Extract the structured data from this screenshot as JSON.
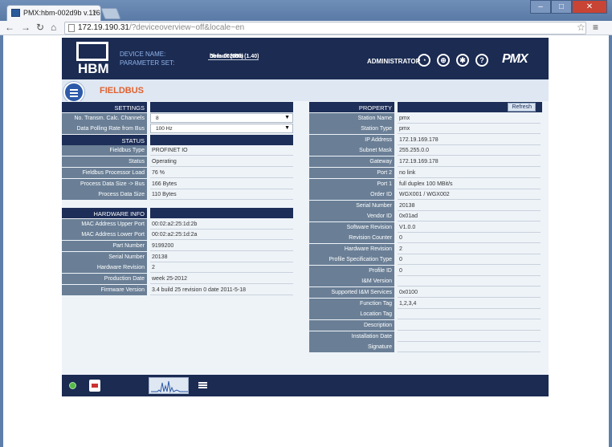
{
  "browser": {
    "tab_title": "PMX:hbm-002d9b v.116...",
    "url_host": "172.19.190.31",
    "url_rest": "/?deviceoverview~off&locale~en"
  },
  "header": {
    "logo_text": "HBM",
    "device_name_label": "DEVICE NAME:",
    "device_name": "hbm-002d9b (1.40)",
    "parameter_set_label": "PARAMETER SET:",
    "parameter_set": "Default (000)",
    "user": "ADMINISTRATOR",
    "brand": "PMX",
    "icons": [
      "gauge-icon",
      "globe-icon",
      "gear-icon",
      "help-icon"
    ]
  },
  "page": {
    "title": "FIELDBUS"
  },
  "settings": {
    "title": "SETTINGS",
    "rows": [
      {
        "label": "No. Transm. Calc. Channels",
        "value": "8"
      },
      {
        "label": "Data Polling Rate from Bus",
        "value": "100 Hz"
      }
    ]
  },
  "status": {
    "title": "STATUS",
    "rows": [
      {
        "label": "Fieldbus Type",
        "value": "PROFINET IO"
      },
      {
        "label": "Status",
        "value": "Operating"
      },
      {
        "label": "Fieldbus Processor Load",
        "value": "76 %"
      },
      {
        "label": "Process Data Size -> Bus",
        "value": "166 Bytes"
      },
      {
        "label": "Process Data Size",
        "value": "110 Bytes"
      }
    ]
  },
  "hardware": {
    "title": "HARDWARE INFO",
    "rows": [
      {
        "label": "MAC Address Upper Port",
        "value": "00:02:a2:25:1d:2b"
      },
      {
        "label": "MAC Address Lower Port",
        "value": "00:02:a2:25:1d:2a"
      },
      {
        "label": "Part Number",
        "value": "9199200"
      },
      {
        "label": "Serial Number",
        "value": "20138"
      },
      {
        "label": "Hardware Revision",
        "value": "2"
      },
      {
        "label": "Production Date",
        "value": "week 25-2012"
      },
      {
        "label": "Firmware Version",
        "value": "3.4 build 25 revision 0 date 2011-5-18"
      }
    ]
  },
  "property": {
    "title": "PROPERTY",
    "refresh_label": "Refresh",
    "rows": [
      {
        "label": "Station Name",
        "value": "pmx"
      },
      {
        "label": "Station Type",
        "value": "pmx"
      },
      {
        "label": "IP Address",
        "value": "172.19.169.178"
      },
      {
        "label": "Subnet Mask",
        "value": "255.255.0.0"
      },
      {
        "label": "Gateway",
        "value": "172.19.169.178"
      },
      {
        "label": "Port 2",
        "value": "no link"
      },
      {
        "label": "Port 1",
        "value": "full duplex 100 MBit/s"
      },
      {
        "label": "Order ID",
        "value": "WGX001 / WGX002"
      },
      {
        "label": "Serial Number",
        "value": "20138"
      },
      {
        "label": "Vendor ID",
        "value": "0x01ad"
      },
      {
        "label": "Software Revision",
        "value": "V1.0.0"
      },
      {
        "label": "Revision Counter",
        "value": "0"
      },
      {
        "label": "Hardware Revision",
        "value": "2"
      },
      {
        "label": "Profile Specification Type",
        "value": "0"
      },
      {
        "label": "Profile ID",
        "value": "0"
      },
      {
        "label": "I&M Version",
        "value": ""
      },
      {
        "label": "Supported I&M Services",
        "value": "0x0100"
      },
      {
        "label": "Function Tag",
        "value": "1,2,3,4"
      },
      {
        "label": "Location Tag",
        "value": ""
      },
      {
        "label": "Description",
        "value": ""
      },
      {
        "label": "Installation Date",
        "value": ""
      },
      {
        "label": "Signature",
        "value": ""
      }
    ]
  }
}
